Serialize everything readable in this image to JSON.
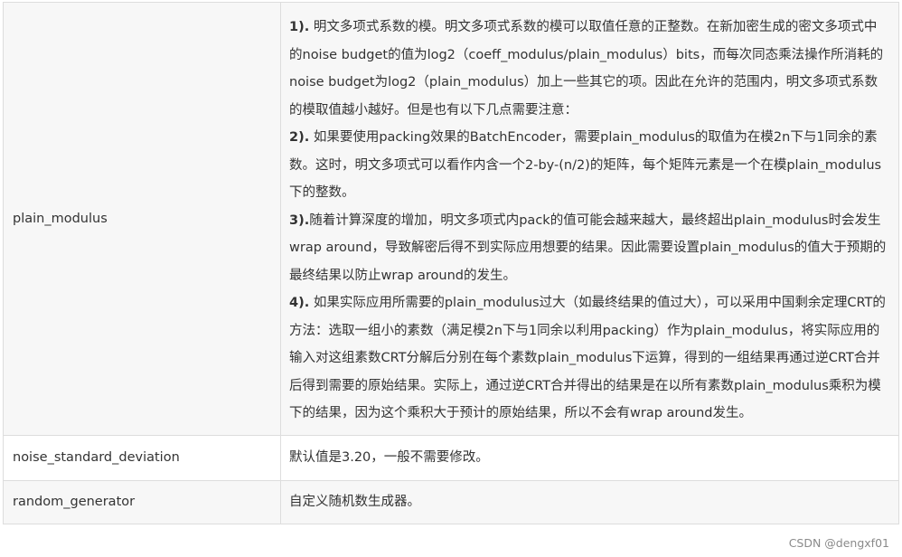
{
  "rows": [
    {
      "name": "plain_modulus",
      "paragraphs": [
        {
          "num": "1).",
          "text": " 明文多项式系数的模。明文多项式系数的模可以取值任意的正整数。在新加密生成的密文多项式中的noise budget的值为log2（coeff_modulus/plain_modulus）bits，而每次同态乘法操作所消耗的noise budget为log2（plain_modulus）加上一些其它的项。因此在允许的范围内，明文多项式系数的模取值越小越好。但是也有以下几点需要注意："
        },
        {
          "num": "2).",
          "text": " 如果要使用packing效果的BatchEncoder，需要plain_modulus的取值为在模2n下与1同余的素数。这时，明文多项式可以看作内含一个2-by-(n/2)的矩阵，每个矩阵元素是一个在模plain_modulus下的整数。"
        },
        {
          "num": "3).",
          "text": "随着计算深度的增加，明文多项式内pack的值可能会越来越大，最终超出plain_modulus时会发生wrap around，导致解密后得不到实际应用想要的结果。因此需要设置plain_modulus的值大于预期的最终结果以防止wrap around的发生。"
        },
        {
          "num": "4).",
          "text": " 如果实际应用所需要的plain_modulus过大（如最终结果的值过大），可以采用中国剩余定理CRT的方法：选取一组小的素数（满足模2n下与1同余以利用packing）作为plain_modulus，将实际应用的输入对这组素数CRT分解后分别在每个素数plain_modulus下运算，得到的一组结果再通过逆CRT合并后得到需要的原始结果。实际上，通过逆CRT合并得出的结果是在以所有素数plain_modulus乘积为模下的结果，因为这个乘积大于预计的原始结果，所以不会有wrap around发生。"
        }
      ]
    },
    {
      "name": "noise_standard_deviation",
      "desc": "默认值是3.20，一般不需要修改。"
    },
    {
      "name": "random_generator",
      "desc": "自定义随机数生成器。"
    }
  ],
  "watermark": "CSDN @dengxf01"
}
